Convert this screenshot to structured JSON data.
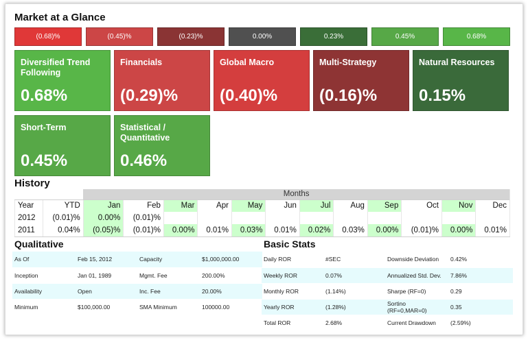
{
  "market": {
    "title": "Market at a Glance",
    "scale": [
      {
        "label": "(0.68)%",
        "color": "#e03838"
      },
      {
        "label": "(0.45)%",
        "color": "#cc4646"
      },
      {
        "label": "(0.23)%",
        "color": "#8a3434"
      },
      {
        "label": "0.00%",
        "color": "#505050"
      },
      {
        "label": "0.23%",
        "color": "#3a6e38"
      },
      {
        "label": "0.45%",
        "color": "#57a847"
      },
      {
        "label": "0.68%",
        "color": "#58b648"
      }
    ],
    "tiles": [
      {
        "name": "Diversified Trend Following",
        "value": "0.68%",
        "color": "#58b648"
      },
      {
        "name": "Financials",
        "value": "(0.29)%",
        "color": "#cc4646"
      },
      {
        "name": "Global Macro",
        "value": "(0.40)%",
        "color": "#d43e3e"
      },
      {
        "name": "Multi-Strategy",
        "value": "(0.16)%",
        "color": "#8e3434"
      },
      {
        "name": "Natural Resources",
        "value": "0.15%",
        "color": "#3a6a3a"
      },
      {
        "name": "Short-Term",
        "value": "0.45%",
        "color": "#57a847"
      },
      {
        "name": "Statistical / Quantitative",
        "value": "0.46%",
        "color": "#57a847"
      }
    ]
  },
  "history": {
    "title": "History",
    "months_label": "Months",
    "headers": [
      "Year",
      "YTD",
      "Jan",
      "Feb",
      "Mar",
      "Apr",
      "May",
      "Jun",
      "Jul",
      "Aug",
      "Sep",
      "Oct",
      "Nov",
      "Dec"
    ],
    "rows": [
      [
        "2012",
        "(0.01)%",
        "0.00%",
        "(0.01)%",
        "",
        "",
        "",
        "",
        "",
        "",
        "",
        "",
        "",
        ""
      ],
      [
        "2011",
        "0.04%",
        "(0.05)%",
        "(0.01)%",
        "0.00%",
        "0.01%",
        "0.03%",
        "0.01%",
        "0.02%",
        "0.03%",
        "0.00%",
        "(0.01)%",
        "0.00%",
        "0.01%"
      ]
    ]
  },
  "qualitative": {
    "title": "Qualitative",
    "rows": [
      [
        "As Of",
        "Feb 15, 2012",
        "Capacity",
        "$1,000,000.00"
      ],
      [
        "Inception",
        "Jan 01, 1989",
        "Mgmt. Fee",
        "200.00%"
      ],
      [
        "Availability",
        "Open",
        "Inc. Fee",
        "20.00%"
      ],
      [
        "Minimum",
        "$100,000.00",
        "SMA Minimum",
        "100000.00"
      ]
    ]
  },
  "basic_stats": {
    "title": "Basic Stats",
    "rows": [
      [
        "Daily ROR",
        "#SEC",
        "Downside Deviation",
        "0.42%"
      ],
      [
        "Weekly ROR",
        "0.07%",
        "Annualized Std. Dev.",
        "7.86%"
      ],
      [
        "Monthly ROR",
        "(1.14%)",
        "Sharpe (RF=0)",
        "0.29"
      ],
      [
        "Yearly ROR",
        "(1.28%)",
        "Sortino (RF=0,MAR=0)",
        "0.35"
      ],
      [
        "Total ROR",
        "2.68%",
        "Current Drawdown",
        "(2.59%)"
      ]
    ]
  }
}
